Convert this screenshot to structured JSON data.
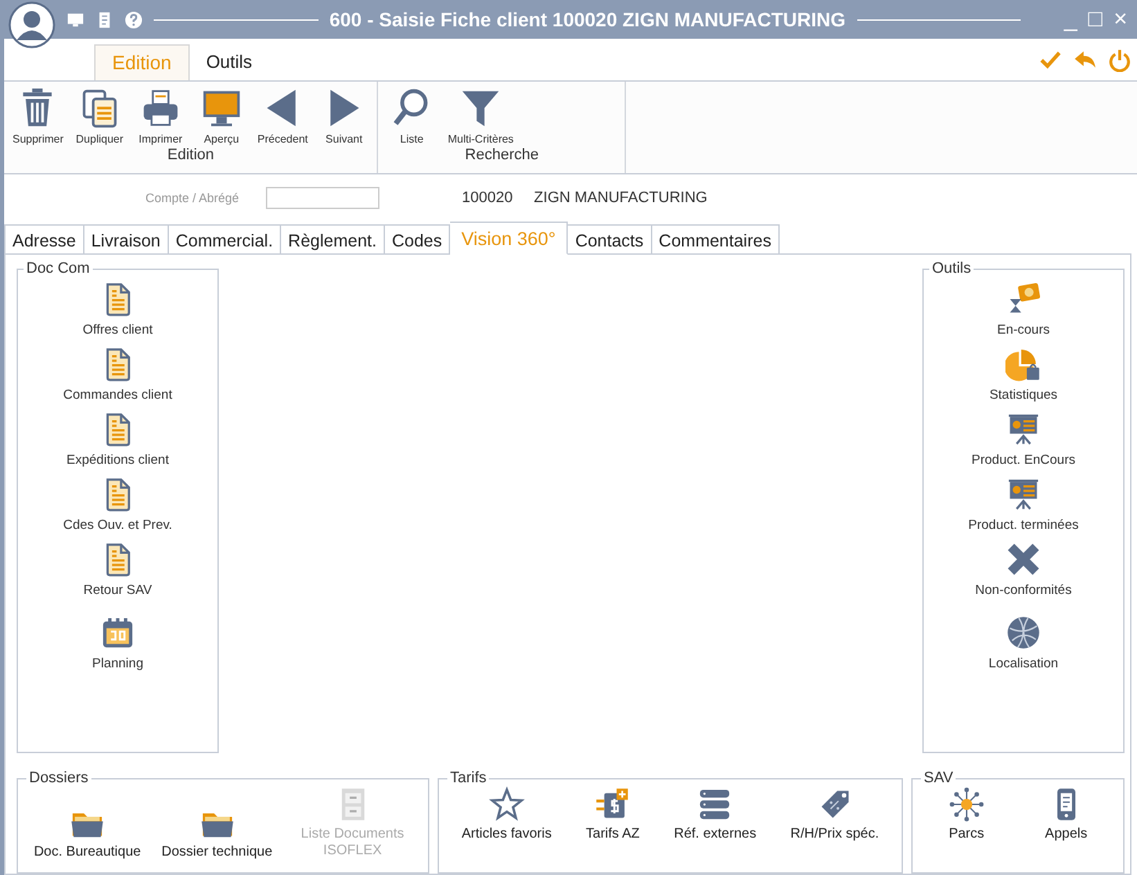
{
  "window": {
    "title": "600 - Saisie Fiche client 100020 ZIGN MANUFACTURING",
    "controls": [
      "_",
      "□",
      "×"
    ]
  },
  "ribbon_tabs": [
    {
      "label": "Edition",
      "selected": true
    },
    {
      "label": "Outils",
      "selected": false
    }
  ],
  "toolbar_groups": [
    {
      "label": "Edition",
      "buttons": [
        {
          "label": "Supprimer",
          "kind": "trash"
        },
        {
          "label": "Dupliquer",
          "kind": "copy"
        },
        {
          "label": "Imprimer",
          "kind": "printer"
        },
        {
          "label": "Aperçu",
          "kind": "monitor"
        },
        {
          "label": "Précedent",
          "kind": "prev"
        },
        {
          "label": "Suivant",
          "kind": "next"
        }
      ]
    },
    {
      "label": "Recherche",
      "buttons": [
        {
          "label": "Liste",
          "kind": "search"
        },
        {
          "label": "Multi-Critères",
          "kind": "filter"
        }
      ]
    }
  ],
  "account": {
    "label": "Compte / Abrégé",
    "code": "100020",
    "name": "ZIGN MANUFACTURING"
  },
  "tabs": [
    {
      "label": "Adresse",
      "selected": false
    },
    {
      "label": "Livraison",
      "selected": false
    },
    {
      "label": "Commercial.",
      "selected": false
    },
    {
      "label": "Règlement.",
      "selected": false
    },
    {
      "label": "Codes",
      "selected": false
    },
    {
      "label": "Vision 360°",
      "selected": true
    },
    {
      "label": "Contacts",
      "selected": false
    },
    {
      "label": "Commentaires",
      "selected": false
    }
  ],
  "doc_com": {
    "title": "Doc Com",
    "items": [
      {
        "label": "Offres client",
        "kind": "doc"
      },
      {
        "label": "Commandes client",
        "kind": "doc"
      },
      {
        "label": "Expéditions client",
        "kind": "doc"
      },
      {
        "label": "Cdes Ouv. et Prev.",
        "kind": "doc"
      },
      {
        "label": "Retour SAV",
        "kind": "doc"
      },
      {
        "label": "Planning",
        "kind": "calendar"
      }
    ]
  },
  "outils": {
    "title": "Outils",
    "items": [
      {
        "label": "En-cours",
        "kind": "money"
      },
      {
        "label": "Statistiques",
        "kind": "pie"
      },
      {
        "label": "Product. EnCours",
        "kind": "board"
      },
      {
        "label": "Product. terminées",
        "kind": "board"
      },
      {
        "label": "Non-conformités",
        "kind": "cross"
      },
      {
        "label": "Localisation",
        "kind": "globe"
      }
    ]
  },
  "bottom_groups": [
    {
      "title": "Dossiers",
      "items": [
        {
          "label": "Doc. Bureautique",
          "kind": "folder",
          "disabled": false
        },
        {
          "label": "Dossier technique",
          "kind": "folder",
          "disabled": false
        },
        {
          "label": "Liste Documents ISOFLEX",
          "kind": "cabinet",
          "disabled": true
        }
      ]
    },
    {
      "title": "Tarifs",
      "items": [
        {
          "label": "Articles favoris",
          "kind": "star",
          "disabled": false
        },
        {
          "label": "Tarifs AZ",
          "kind": "tariff",
          "disabled": false
        },
        {
          "label": "Réf. externes",
          "kind": "server",
          "disabled": false
        },
        {
          "label": "R/H/Prix spéc.",
          "kind": "tag",
          "disabled": false
        }
      ]
    },
    {
      "title": "SAV",
      "items": [
        {
          "label": "Parcs",
          "kind": "network",
          "disabled": false
        },
        {
          "label": "Appels",
          "kind": "phone",
          "disabled": false
        }
      ]
    }
  ]
}
